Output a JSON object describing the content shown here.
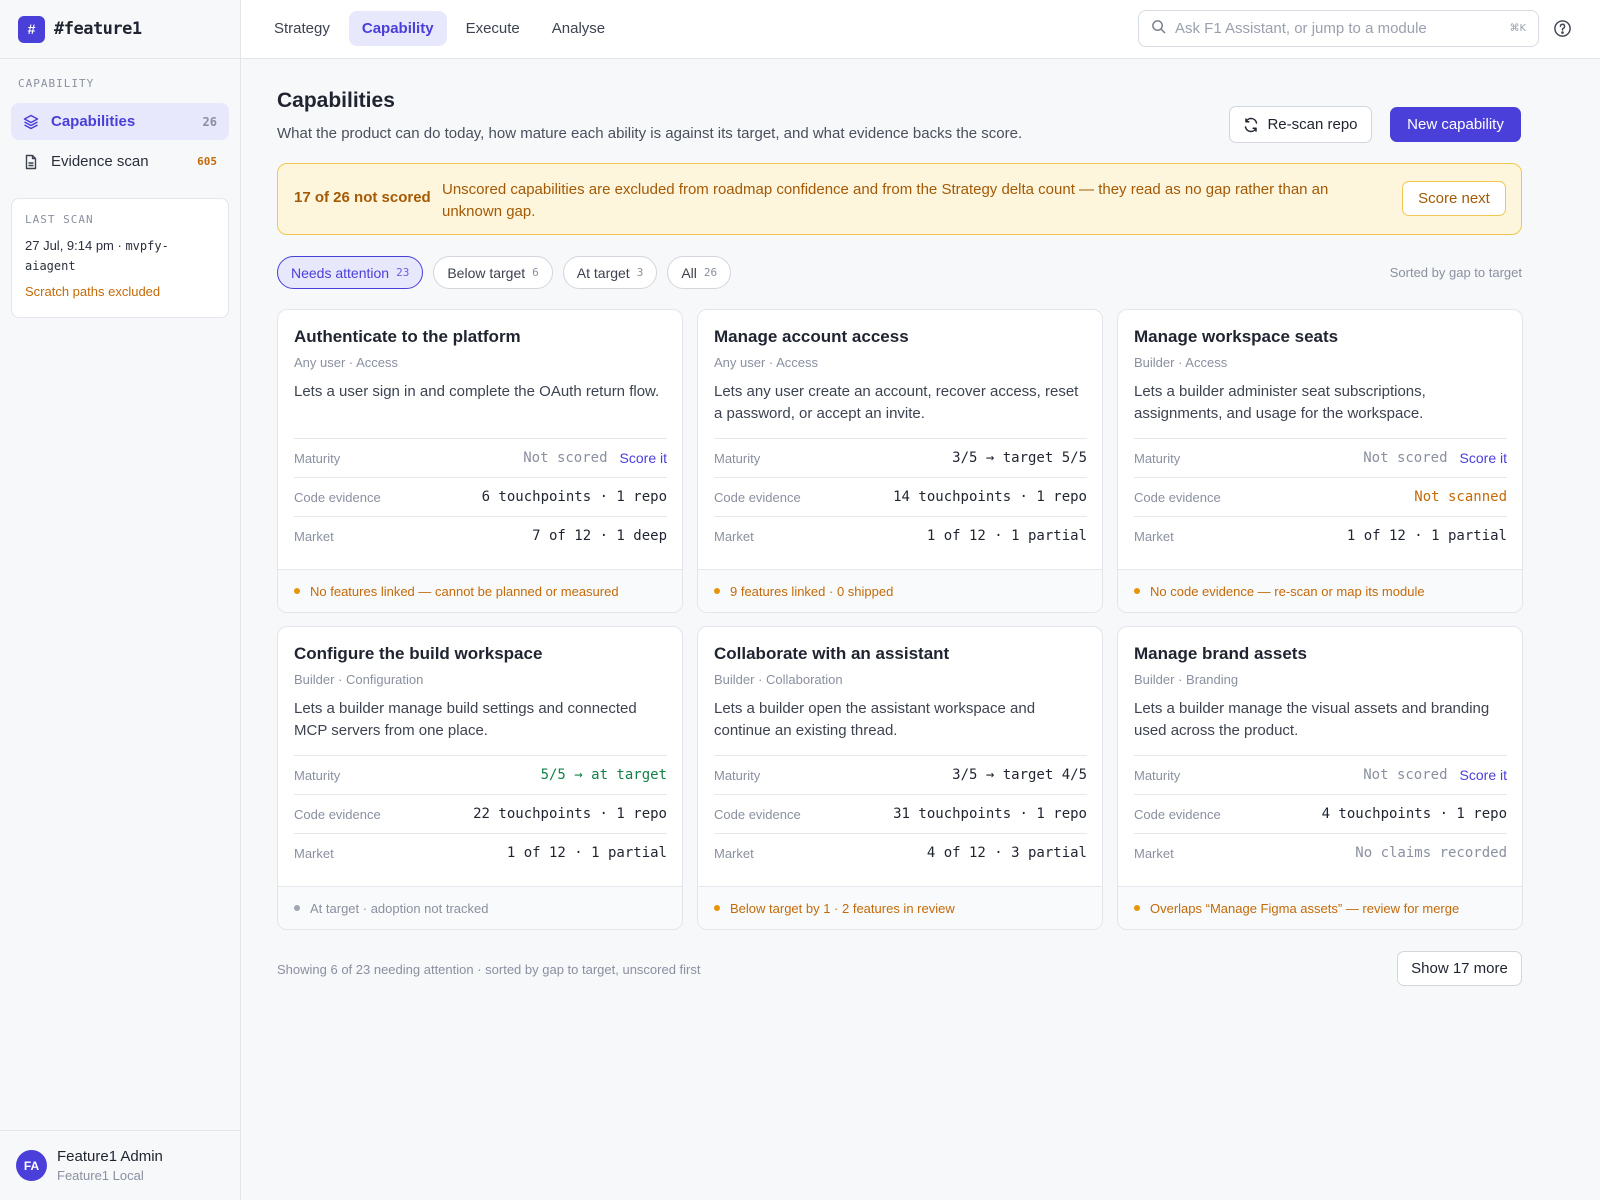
{
  "brand": {
    "mark": "#",
    "name": "#feature1"
  },
  "sidebar": {
    "section": "CAPABILITY",
    "items": [
      {
        "label": "Capabilities",
        "count": "26",
        "icon": "layers-icon"
      },
      {
        "label": "Evidence scan",
        "count": "605",
        "icon": "file-icon"
      }
    ],
    "scan": {
      "label": "LAST SCAN",
      "date": "27 Jul, 9:14 pm · ",
      "repo": "mvpfy-aiagent",
      "note": "Scratch paths excluded"
    }
  },
  "user": {
    "initials": "FA",
    "name": "Feature1 Admin",
    "org": "Feature1 Local"
  },
  "topnav": {
    "tabs": [
      "Strategy",
      "Capability",
      "Execute",
      "Analyse"
    ],
    "active": "Capability"
  },
  "search": {
    "placeholder": "Ask F1 Assistant, or jump to a module",
    "shortcut": "⌘K"
  },
  "page": {
    "title": "Capabilities",
    "subtitle": "What the product can do today, how mature each ability is against its target, and what evidence backs the score.",
    "rescan_label": "Re-scan repo",
    "new_label": "New capability"
  },
  "banner": {
    "strong": "17 of 26 not scored",
    "text": "Unscored capabilities are excluded from roadmap confidence and from the Strategy delta count — they read as no gap rather than an unknown gap.",
    "action": "Score next"
  },
  "filters": [
    {
      "label": "Needs attention",
      "count": "23"
    },
    {
      "label": "Below target",
      "count": "6"
    },
    {
      "label": "At target",
      "count": "3"
    },
    {
      "label": "All",
      "count": "26"
    }
  ],
  "sort_note": "Sorted by gap to target",
  "row_labels": {
    "maturity": "Maturity",
    "code": "Code evidence",
    "market": "Market"
  },
  "score_it": "Score it",
  "cards": [
    {
      "title": "Authenticate to the platform",
      "meta": "Any user · Access",
      "desc": "Lets a user sign in and complete the OAuth return flow.",
      "maturity": "Not scored",
      "code": "6 touchpoints · 1 repo",
      "market": "7 of 12 · 1 deep",
      "footer": "No features linked — cannot be planned or measured"
    },
    {
      "title": "Manage account access",
      "meta": "Any user · Access",
      "desc": "Lets any user create an account, recover access, reset a password, or accept an invite.",
      "maturity": "3/5 → target 5/5",
      "code": "14 touchpoints · 1 repo",
      "market": "1 of 12 · 1 partial",
      "footer": "9 features linked · 0 shipped"
    },
    {
      "title": "Manage workspace seats",
      "meta": "Builder · Access",
      "desc": "Lets a builder administer seat subscriptions, assignments, and usage for the workspace.",
      "maturity": "Not scored",
      "code": "Not scanned",
      "market": "1 of 12 · 1 partial",
      "footer": "No code evidence — re-scan or map its module"
    },
    {
      "title": "Configure the build workspace",
      "meta": "Builder · Configuration",
      "desc": "Lets a builder manage build settings and connected MCP servers from one place.",
      "maturity": "5/5 → at target",
      "code": "22 touchpoints · 1 repo",
      "market": "1 of 12 · 1 partial",
      "footer": "At target · adoption not tracked"
    },
    {
      "title": "Collaborate with an assistant",
      "meta": "Builder · Collaboration",
      "desc": "Lets a builder open the assistant workspace and continue an existing thread.",
      "maturity": "3/5 → target 4/5",
      "code": "31 touchpoints · 1 repo",
      "market": "4 of 12 · 3 partial",
      "footer": "Below target by 1 · 2 features in review"
    },
    {
      "title": "Manage brand assets",
      "meta": "Builder · Branding",
      "desc": "Lets a builder manage the visual assets and branding used across the product.",
      "maturity": "Not scored",
      "code": "4 touchpoints · 1 repo",
      "market": "No claims recorded",
      "footer": "Overlaps “Manage Figma assets” — review for merge"
    }
  ],
  "showing": "Showing 6 of 23 needing attention · sorted by gap to target, unscored first",
  "show_more": "Show 17 more",
  "colors": {
    "accent": "#4b3fd9",
    "warn": "#c46a08",
    "good": "#13804a",
    "banner_bg": "#fef6dc"
  }
}
